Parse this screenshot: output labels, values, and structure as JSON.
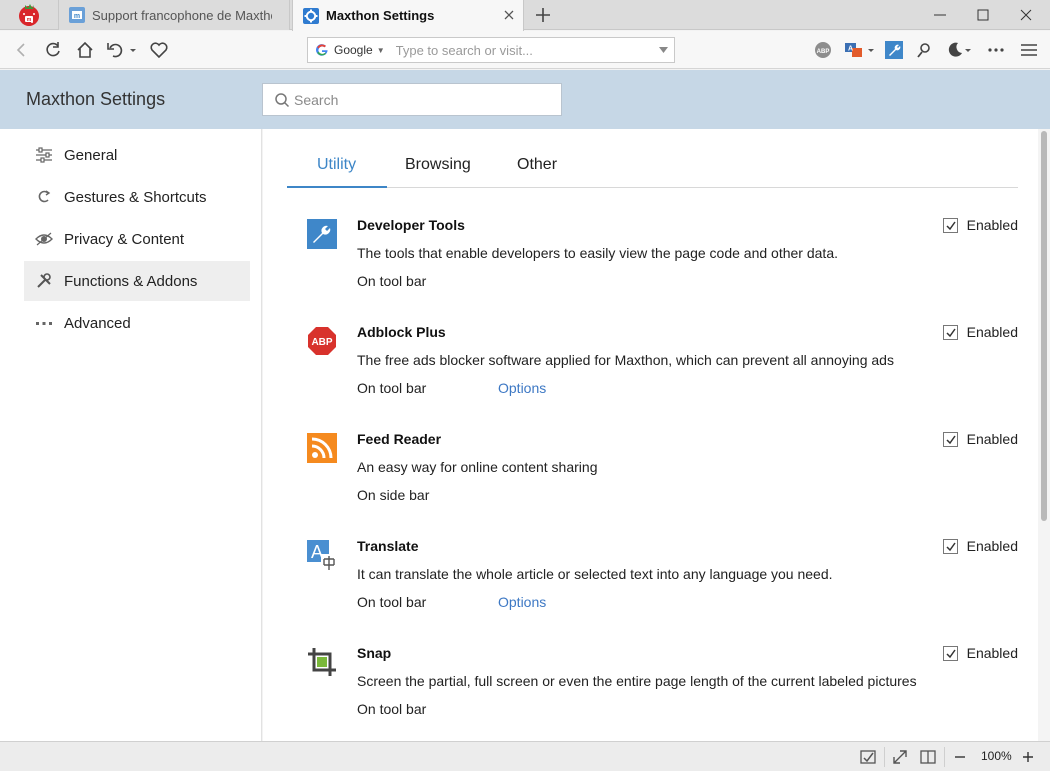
{
  "browser": {
    "tabs": [
      {
        "title": "Support francophone de Maxthon",
        "active": false
      },
      {
        "title": "Maxthon Settings",
        "active": true
      }
    ],
    "address": {
      "engine": "Google",
      "placeholder": "Type to search or visit..."
    },
    "zoom": "100%"
  },
  "settings": {
    "title": "Maxthon Settings",
    "search_placeholder": "Search",
    "nav": [
      {
        "label": "General",
        "icon": "sliders-icon",
        "active": false
      },
      {
        "label": "Gestures & Shortcuts",
        "icon": "gesture-icon",
        "active": false
      },
      {
        "label": "Privacy & Content",
        "icon": "eye-icon",
        "active": false
      },
      {
        "label": "Functions & Addons",
        "icon": "tools-icon",
        "active": true
      },
      {
        "label": "Advanced",
        "icon": "more-dots-icon",
        "active": false
      }
    ],
    "tabs": [
      {
        "label": "Utility",
        "active": true
      },
      {
        "label": "Browsing",
        "active": false
      },
      {
        "label": "Other",
        "active": false
      }
    ],
    "enabled_label": "Enabled",
    "features": [
      {
        "name": "Developer Tools",
        "description": "The tools that enable developers to easily view the page code and other data.",
        "location": "On tool bar",
        "options": "",
        "enabled": true,
        "icon": "wrench-icon",
        "color": "#3f87c9"
      },
      {
        "name": "Adblock Plus",
        "description": "The free ads blocker software applied for Maxthon, which can prevent all annoying ads",
        "location": "On tool bar",
        "options": "Options",
        "enabled": true,
        "icon": "adblock-icon",
        "color": "#d8322c"
      },
      {
        "name": "Feed Reader",
        "description": "An easy way for online content sharing",
        "location": "On side bar",
        "options": "",
        "enabled": true,
        "icon": "rss-icon",
        "color": "#f58a1f"
      },
      {
        "name": "Translate",
        "description": "It can translate the whole article or selected text into any language you need.",
        "location": "On tool bar",
        "options": "Options",
        "enabled": true,
        "icon": "translate-icon",
        "color": "#3f87c9"
      },
      {
        "name": "Snap",
        "description": "Screen the partial, full screen or even the entire page length of the current labeled pictures",
        "location": "On tool bar",
        "options": "",
        "enabled": true,
        "icon": "crop-icon",
        "color": "#444444"
      }
    ]
  }
}
